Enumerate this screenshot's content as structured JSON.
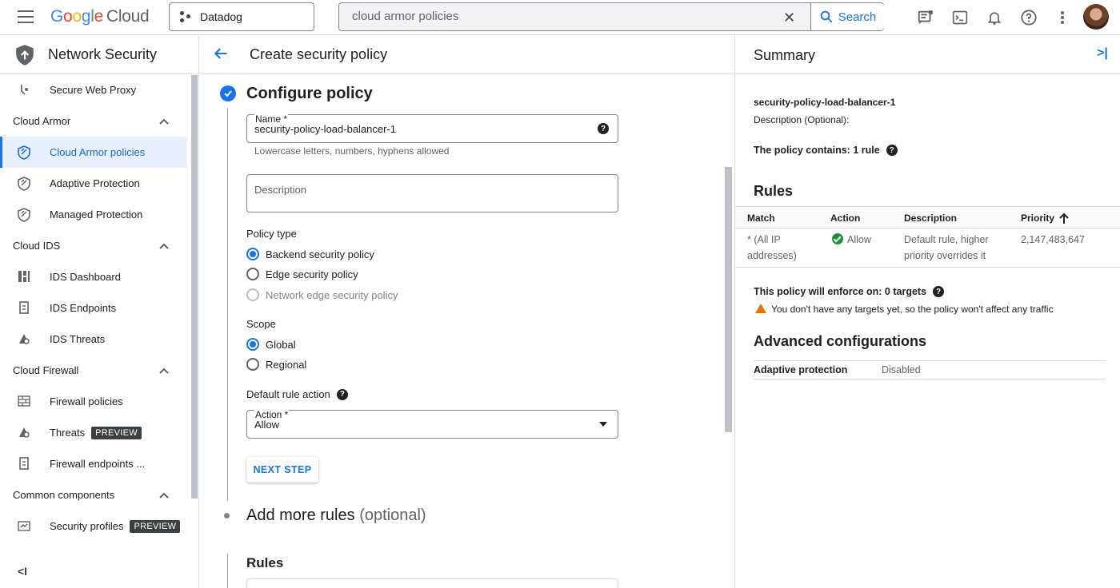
{
  "topbar": {
    "logo_google": "Google",
    "logo_cloud": "Cloud",
    "project": "Datadog",
    "search_value": "cloud armor policies",
    "search_button": "Search"
  },
  "sidebar": {
    "title": "Network Security",
    "items": [
      {
        "type": "item",
        "label": "Secure Web Proxy",
        "icon": "proxy-icon"
      },
      {
        "type": "group",
        "label": "Cloud Armor"
      },
      {
        "type": "item",
        "label": "Cloud Armor policies",
        "icon": "shield-icon",
        "active": true
      },
      {
        "type": "item",
        "label": "Adaptive Protection",
        "icon": "shield-icon"
      },
      {
        "type": "item",
        "label": "Managed Protection",
        "icon": "shield-icon"
      },
      {
        "type": "group",
        "label": "Cloud IDS"
      },
      {
        "type": "item",
        "label": "IDS Dashboard",
        "icon": "dashboard-icon"
      },
      {
        "type": "item",
        "label": "IDS Endpoints",
        "icon": "endpoint-icon"
      },
      {
        "type": "item",
        "label": "IDS Threats",
        "icon": "threat-icon"
      },
      {
        "type": "group",
        "label": "Cloud Firewall"
      },
      {
        "type": "item",
        "label": "Firewall policies",
        "icon": "firewall-icon"
      },
      {
        "type": "item",
        "label": "Threats",
        "icon": "threat-icon",
        "badge": "PREVIEW"
      },
      {
        "type": "item",
        "label": "Firewall endpoints ...",
        "icon": "endpoint-icon"
      },
      {
        "type": "group",
        "label": "Common components"
      },
      {
        "type": "item",
        "label": "Security profiles",
        "icon": "profile-icon",
        "badge": "PREVIEW"
      }
    ]
  },
  "main": {
    "title": "Create security policy",
    "step1_title": "Configure policy",
    "name_label": "Name *",
    "name_value": "security-policy-load-balancer-1",
    "name_hint": "Lowercase letters, numbers, hyphens allowed",
    "description_placeholder": "Description",
    "policy_type_label": "Policy type",
    "policy_types": [
      "Backend security policy",
      "Edge security policy",
      "Network edge security policy"
    ],
    "scope_label": "Scope",
    "scopes": [
      "Global",
      "Regional"
    ],
    "default_action_label": "Default rule action",
    "action_label": "Action *",
    "action_value": "Allow",
    "next_step": "NEXT STEP",
    "step2_title": "Add more rules",
    "step2_optional": "(optional)",
    "rules_title": "Rules"
  },
  "summary": {
    "title": "Summary",
    "policy_name": "security-policy-load-balancer-1",
    "description": "Description (Optional):",
    "contains": "The policy contains: 1 rule",
    "rules_heading": "Rules",
    "columns": [
      "Match",
      "Action",
      "Description",
      "Priority"
    ],
    "row": {
      "match_line1": "* (All IP",
      "match_line2": "addresses)",
      "action": "Allow",
      "desc_line1": "Default rule, higher",
      "desc_line2": "priority overrides it",
      "priority": "2,147,483,647"
    },
    "enforce": "This policy will enforce on: 0 targets",
    "warning": "You don't have any targets yet, so the policy won't affect any traffic",
    "advanced_heading": "Advanced configurations",
    "adaptive_label": "Adaptive protection",
    "adaptive_value": "Disabled"
  },
  "colors": {
    "accent": "#1a73e8",
    "active_bg": "#e8f0fe",
    "success": "#1e8e3e",
    "warning": "#e37400"
  }
}
